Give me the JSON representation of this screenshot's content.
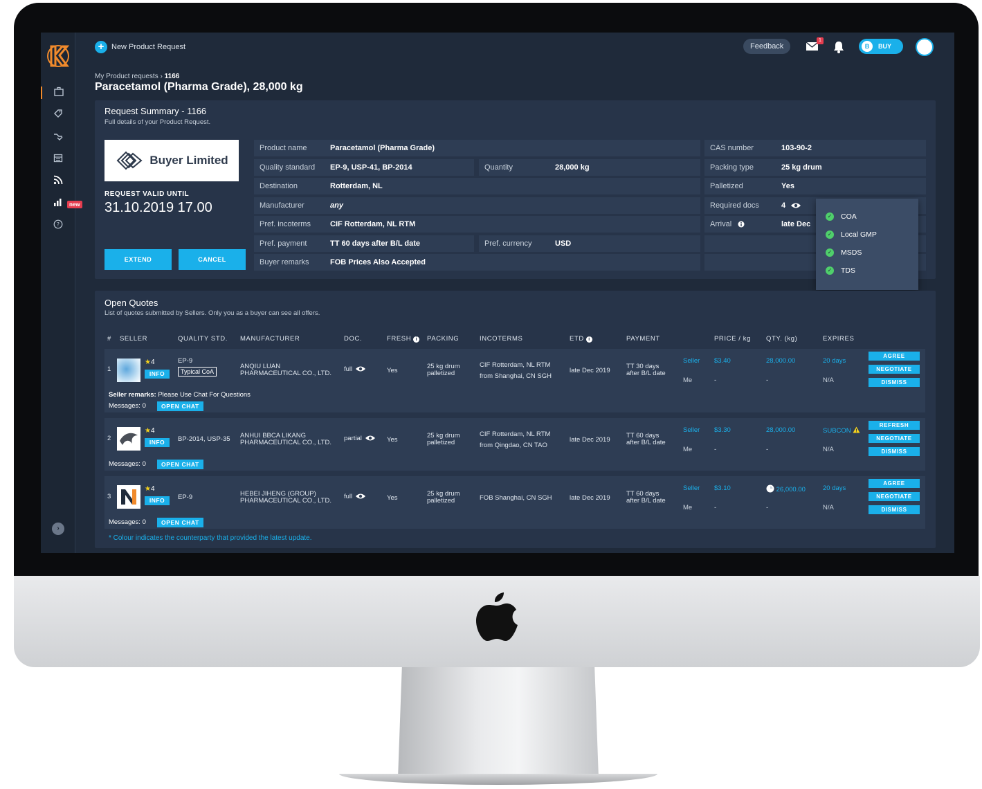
{
  "topbar": {
    "new_request_label": "New Product Request",
    "feedback_label": "Feedback",
    "mail_badge": "1",
    "buy_toggle_letter": "B",
    "buy_toggle_label": "BUY"
  },
  "sidenav": {
    "new_badge": "new"
  },
  "breadcrumb": {
    "parent": "My Product requests",
    "separator": "›",
    "current": "1166"
  },
  "page_title": "Paracetamol (Pharma Grade), 28,000 kg",
  "summary": {
    "title": "Request Summary - 1166",
    "subtitle": "Full details of your Product Request.",
    "buyer_name": "Buyer Limited",
    "valid_label": "REQUEST VALID UNTIL",
    "valid_date": "31.10.2019 17.00",
    "extend_label": "EXTEND",
    "cancel_label": "CANCEL",
    "fields": {
      "product_name": {
        "k": "Product name",
        "v": "Paracetamol (Pharma Grade)"
      },
      "quality_standard": {
        "k": "Quality standard",
        "v": "EP-9, USP-41, BP-2014"
      },
      "quantity": {
        "k": "Quantity",
        "v": "28,000 kg"
      },
      "destination": {
        "k": "Destination",
        "v": "Rotterdam, NL"
      },
      "manufacturer": {
        "k": "Manufacturer",
        "v": "any"
      },
      "pref_incoterms": {
        "k": "Pref. incoterms",
        "v": "CIF Rotterdam, NL RTM"
      },
      "pref_payment": {
        "k": "Pref. payment",
        "v": "TT 60 days after B/L date"
      },
      "pref_currency": {
        "k": "Pref. currency",
        "v": "USD"
      },
      "buyer_remarks": {
        "k": "Buyer remarks",
        "v": "FOB Prices Also Accepted"
      },
      "cas_number": {
        "k": "CAS number",
        "v": "103-90-2"
      },
      "packing_type": {
        "k": "Packing type",
        "v": "25 kg drum"
      },
      "palletized": {
        "k": "Palletized",
        "v": "Yes"
      },
      "required_docs": {
        "k": "Required docs",
        "v": "4"
      },
      "arrival": {
        "k": "Arrival",
        "v": "late Dec"
      }
    },
    "docs_popup": [
      "COA",
      "Local GMP",
      "MSDS",
      "TDS"
    ]
  },
  "quotes": {
    "title": "Open Quotes",
    "subtitle": "List of quotes submitted by Sellers. Only you as a buyer can see all offers.",
    "headers": {
      "num": "#",
      "seller": "SELLER",
      "quality": "QUALITY STD.",
      "manufacturer": "MANUFACTURER",
      "doc": "DOC.",
      "fresh": "FRESH",
      "packing": "PACKING",
      "incoterms": "INCOTERMS",
      "etd": "ETD",
      "payment": "PAYMENT",
      "price": "PRICE / kg",
      "qty": "QTY. (kg)",
      "expires": "EXPIRES"
    },
    "info_label": "INFO",
    "open_chat_label": "OPEN CHAT",
    "messages_label": "Messages: 0",
    "seller_remarks_label": "Seller remarks:",
    "seller_remarks_text": "Please Use Chat For Questions",
    "rows": [
      {
        "num": "1",
        "rating": "4",
        "quality": "EP-9",
        "coa_tag": "Typical CoA",
        "manufacturer_1": "ANQIU LUAN",
        "manufacturer_2": "PHARMACEUTICAL CO., LTD.",
        "doc": "full",
        "fresh": "Yes",
        "packing_1": "25 kg drum",
        "packing_2": "palletized",
        "incoterms_1": "CIF Rotterdam, NL RTM",
        "incoterms_2": "from Shanghai, CN SGH",
        "etd": "late Dec 2019",
        "payment_1": "TT 30 days",
        "payment_2": "after B/L date",
        "party_seller": "Seller",
        "party_me": "Me",
        "price_seller": "$3.40",
        "price_me": "-",
        "qty_seller": "28,000.00",
        "qty_me": "-",
        "expires_seller": "20 days",
        "expires_me": "N/A",
        "btn1": "AGREE",
        "btn2": "NEGOTIATE",
        "btn3": "DISMISS"
      },
      {
        "num": "2",
        "rating": "4",
        "quality": "BP-2014, USP-35",
        "manufacturer_1": "ANHUI BBCA LIKANG",
        "manufacturer_2": "PHARMACEUTICAL CO., LTD.",
        "doc": "partial",
        "fresh": "Yes",
        "packing_1": "25 kg drum",
        "packing_2": "palletized",
        "incoterms_1": "CIF Rotterdam, NL RTM",
        "incoterms_2": "from Qingdao, CN TAO",
        "etd": "late Dec 2019",
        "payment_1": "TT 60 days",
        "payment_2": "after B/L date",
        "party_seller": "Seller",
        "party_me": "Me",
        "price_seller": "$3.30",
        "price_me": "-",
        "qty_seller": "28,000.00",
        "qty_me": "-",
        "expires_seller": "SUBCON",
        "expires_me": "N/A",
        "btn1": "REFRESH",
        "btn2": "NEGOTIATE",
        "btn3": "DISMISS"
      },
      {
        "num": "3",
        "rating": "4",
        "quality": "EP-9",
        "manufacturer_1": "HEBEI JIHENG (GROUP)",
        "manufacturer_2": "PHARMACEUTICAL CO., LTD.",
        "doc": "full",
        "fresh": "Yes",
        "packing_1": "25 kg drum",
        "packing_2": "palletized",
        "incoterms_1": "FOB Shanghai, CN SGH",
        "etd": "late Dec 2019",
        "payment_1": "TT 60 days",
        "payment_2": "after B/L date",
        "party_seller": "Seller",
        "party_me": "Me",
        "price_seller": "$3.10",
        "price_me": "-",
        "qty_seller": "26,000.00",
        "qty_me": "-",
        "expires_seller": "20 days",
        "expires_me": "N/A",
        "btn1": "AGREE",
        "btn2": "NEGOTIATE",
        "btn3": "DISMISS"
      }
    ],
    "footnote": "* Colour indicates the counterparty that provided the latest update."
  },
  "colors": {
    "accent": "#1ab0ea",
    "brand": "#f08a2c",
    "panel": "#273449",
    "background": "#1f2a3a",
    "alert": "#e53d4f"
  },
  "icons": [
    "k-logo-icon",
    "briefcase-icon",
    "tag-icon",
    "handshake-icon",
    "calendar-icon",
    "rss-icon",
    "chart-icon",
    "help-icon",
    "plus-icon",
    "mail-icon",
    "bell-icon",
    "eye-icon",
    "check-icon",
    "star-icon",
    "warning-icon",
    "clock-icon",
    "info-icon",
    "apple-logo-icon"
  ]
}
